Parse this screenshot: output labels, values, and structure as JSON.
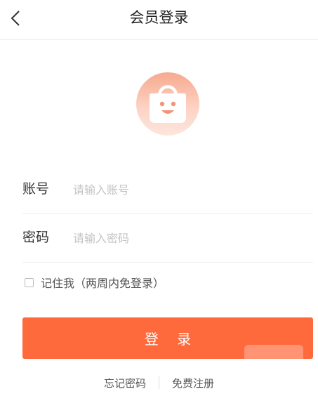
{
  "header": {
    "title": "会员登录",
    "back_icon": "chevron-left-icon"
  },
  "logo": {
    "icon": "shopping-bag-smile-icon",
    "colors": [
      "#f7a98f",
      "#fde6dc"
    ]
  },
  "form": {
    "account_label": "账号",
    "account_placeholder": "请输入账号",
    "account_value": "",
    "password_label": "密码",
    "password_placeholder": "请输入密码",
    "password_value": "",
    "remember_label": "记住我（两周内免登录）",
    "remember_checked": false
  },
  "login_button": "登 录",
  "links": {
    "forgot": "忘记密码",
    "register": "免费注册"
  },
  "colors": {
    "accent": "#ff6a3d",
    "divider": "#eeeeee",
    "placeholder": "#c4c4c4"
  }
}
